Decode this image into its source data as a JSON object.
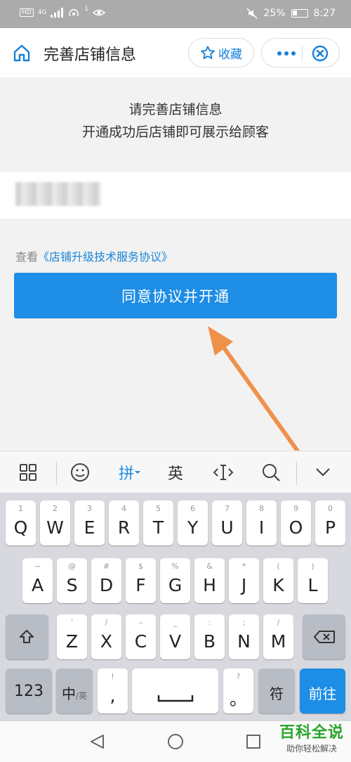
{
  "status_bar": {
    "battery": "25%",
    "time": "8:27",
    "signal_labels": [
      "HD",
      "4G",
      "1"
    ]
  },
  "header": {
    "title": "完善店铺信息",
    "favorite_label": "收藏"
  },
  "intro": {
    "line1": "请完善店铺信息",
    "line2": "开通成功后店铺即可展示给顾客"
  },
  "agreement": {
    "prefix": "查看",
    "link": "《店铺升级技术服务协议》"
  },
  "primary_button": "同意协议并开通",
  "keyboard": {
    "toolbar": {
      "pinyin": "拼",
      "english": "英"
    },
    "row1": [
      {
        "sub": "1",
        "main": "Q"
      },
      {
        "sub": "2",
        "main": "W"
      },
      {
        "sub": "3",
        "main": "E"
      },
      {
        "sub": "4",
        "main": "R"
      },
      {
        "sub": "5",
        "main": "T"
      },
      {
        "sub": "6",
        "main": "Y"
      },
      {
        "sub": "7",
        "main": "U"
      },
      {
        "sub": "8",
        "main": "I"
      },
      {
        "sub": "9",
        "main": "O"
      },
      {
        "sub": "0",
        "main": "P"
      }
    ],
    "row2": [
      {
        "sub": "~",
        "main": "A"
      },
      {
        "sub": "@",
        "main": "S"
      },
      {
        "sub": "#",
        "main": "D"
      },
      {
        "sub": "$",
        "main": "F"
      },
      {
        "sub": "%",
        "main": "G"
      },
      {
        "sub": "&",
        "main": "H"
      },
      {
        "sub": "*",
        "main": "J"
      },
      {
        "sub": "(",
        "main": "K"
      },
      {
        "sub": ")",
        "main": "L"
      }
    ],
    "row3": [
      {
        "sub": "'",
        "main": "Z"
      },
      {
        "sub": "/",
        "main": "X"
      },
      {
        "sub": "–",
        "main": "C"
      },
      {
        "sub": "_",
        "main": "V"
      },
      {
        "sub": ":",
        "main": "B"
      },
      {
        "sub": ";",
        "main": "N"
      },
      {
        "sub": "/",
        "main": "M"
      }
    ],
    "row4": {
      "num": "123",
      "lang_main": "中",
      "lang_sub": "/英",
      "punct_sub": "!",
      "punct_main": ",",
      "period_sub": "?",
      "period_main": "。",
      "symbol": "符",
      "enter": "前往"
    }
  },
  "watermark": {
    "title": "百科全说",
    "subtitle": "助你轻松解决"
  },
  "colors": {
    "accent": "#1d8de6",
    "arrow": "#f0914a",
    "watermark": "#2aa52a"
  }
}
